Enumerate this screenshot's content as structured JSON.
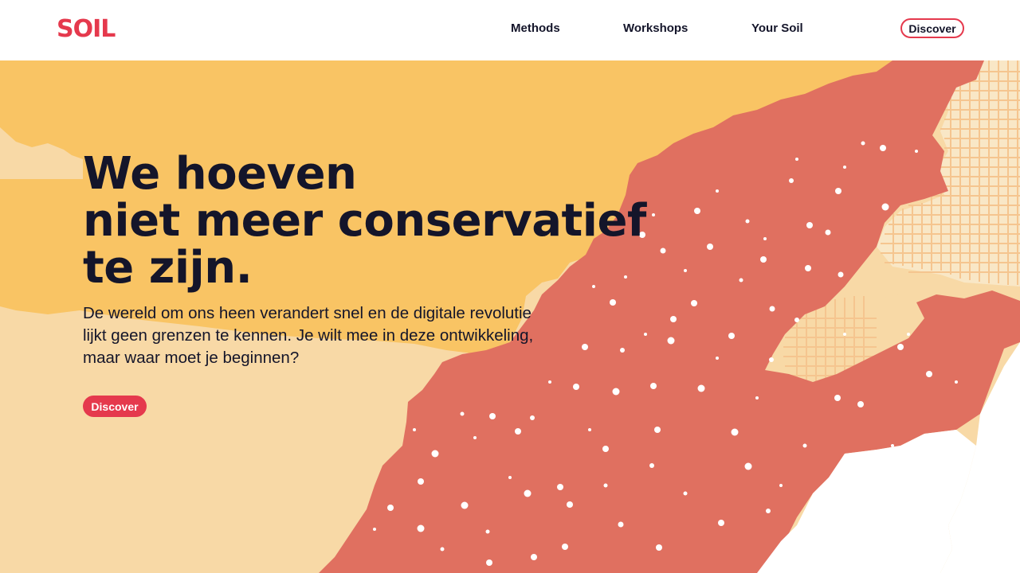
{
  "brand": {
    "logo_text": "SOIL",
    "accent": "#e5394d",
    "ink": "#14152a"
  },
  "nav": {
    "items": [
      "Methods",
      "Workshops",
      "Your Soil"
    ],
    "cta_label": "Discover"
  },
  "hero": {
    "headline": [
      "We hoeven",
      "niet meer conservatief",
      "te zijn."
    ],
    "subtext": "De wereld om ons heen verandert snel en de digitale revolutie lijkt geen grenzen te kennen. Je wilt mee in deze ontwikkeling, maar waar moet je beginnen?",
    "cta_label": "Discover"
  },
  "colors": {
    "sand": "#f8d9a6",
    "yellow": "#f9c464",
    "coral": "#e07060",
    "white": "#ffffff"
  }
}
